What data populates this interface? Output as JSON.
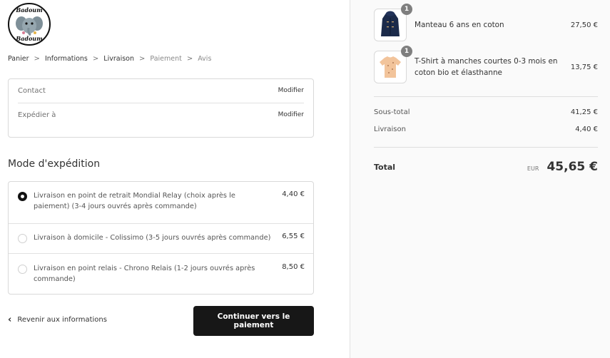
{
  "logo": {
    "text_top": "Badoum",
    "text_bottom": "Badoum"
  },
  "breadcrumb": [
    "Panier",
    "Informations",
    "Livraison",
    "Paiement",
    "Avis"
  ],
  "info_box": {
    "contact_label": "Contact",
    "contact_action": "Modifier",
    "ship_to_label": "Expédier à",
    "ship_to_action": "Modifier"
  },
  "shipping": {
    "title": "Mode d'expédition",
    "options": [
      {
        "label": "Livraison en point de retrait Mondial Relay (choix après le paiement) (3-4 jours ouvrés après commande)",
        "price": "4,40 €",
        "selected": true
      },
      {
        "label": "Livraison à domicile - Colissimo (3-5 jours ouvrés après commande)",
        "price": "6,55 €",
        "selected": false
      },
      {
        "label": "Livraison en point relais - Chrono Relais (1-2 jours ouvrés après commande)",
        "price": "8,50 €",
        "selected": false
      }
    ]
  },
  "actions": {
    "back_label": "Revenir aux informations",
    "continue_label": "Continuer vers le paiement"
  },
  "order": {
    "items": [
      {
        "name": "Manteau 6 ans en coton",
        "price": "27,50 €",
        "qty": "1",
        "image_icon": "navy-coat-icon"
      },
      {
        "name": "T-Shirt à manches courtes 0-3 mois en coton bio et élasthanne",
        "price": "13,75 €",
        "qty": "1",
        "image_icon": "peach-tshirt-icon"
      }
    ],
    "subtotal_label": "Sous-total",
    "subtotal_value": "41,25 €",
    "shipping_label": "Livraison",
    "shipping_value": "4,40 €",
    "total_label": "Total",
    "total_currency": "EUR",
    "total_value": "45,65 €"
  },
  "colors": {
    "button_bg": "#171717",
    "sidebar_bg": "#fafafa",
    "coat": "#1b2a4a",
    "tshirt": "#f2c49b"
  }
}
